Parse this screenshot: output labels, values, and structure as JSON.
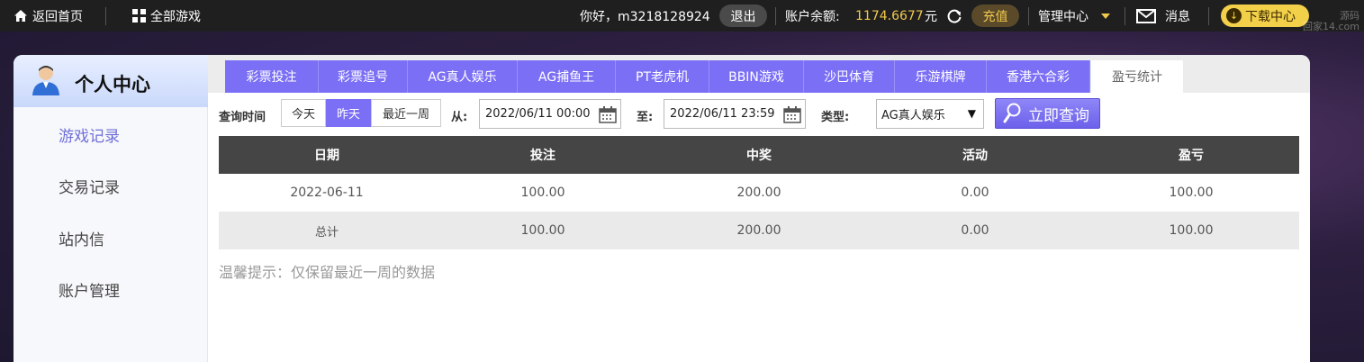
{
  "topbar": {
    "home_label": "返回首页",
    "games_label": "全部游戏",
    "greeting": "你好，m3218128924",
    "logout_label": "退出",
    "balance_label": "账户余额:",
    "balance_value": "1174.6677",
    "balance_unit": "元",
    "recharge_label": "充值",
    "manage_label": "管理中心",
    "message_label": "消息",
    "download_label": "下载中心",
    "watermark_line1": "源码",
    "watermark_line2": "回家14.com"
  },
  "sidebar": {
    "title": "个人中心",
    "items": [
      {
        "label": "游戏记录"
      },
      {
        "label": "交易记录"
      },
      {
        "label": "站内信"
      },
      {
        "label": "账户管理"
      }
    ]
  },
  "tabs": [
    {
      "label": "彩票投注"
    },
    {
      "label": "彩票追号"
    },
    {
      "label": "AG真人娱乐"
    },
    {
      "label": "AG捕鱼王"
    },
    {
      "label": "PT老虎机"
    },
    {
      "label": "BBIN游戏"
    },
    {
      "label": "沙巴体育"
    },
    {
      "label": "乐游棋牌"
    },
    {
      "label": "香港六合彩"
    },
    {
      "label": "盈亏统计"
    }
  ],
  "filter": {
    "query_time_label": "查询时间",
    "ranges": [
      {
        "label": "今天"
      },
      {
        "label": "昨天"
      },
      {
        "label": "最近一周"
      }
    ],
    "from_label": "从:",
    "from_value": "2022/06/11 00:00",
    "to_label": "至:",
    "to_value": "2022/06/11 23:59",
    "type_label": "类型:",
    "type_value": "AG真人娱乐",
    "query_button": "立即查询"
  },
  "table": {
    "headers": [
      "日期",
      "投注",
      "中奖",
      "活动",
      "盈亏"
    ],
    "rows": [
      [
        "2022-06-11",
        "100.00",
        "200.00",
        "0.00",
        "100.00"
      ],
      [
        "总计",
        "100.00",
        "200.00",
        "0.00",
        "100.00"
      ]
    ]
  },
  "tip": "温馨提示：仅保留最近一周的数据",
  "colors": {
    "accent": "#7b6ff5",
    "header_bg": "#454545",
    "gold": "#f2c94c"
  }
}
